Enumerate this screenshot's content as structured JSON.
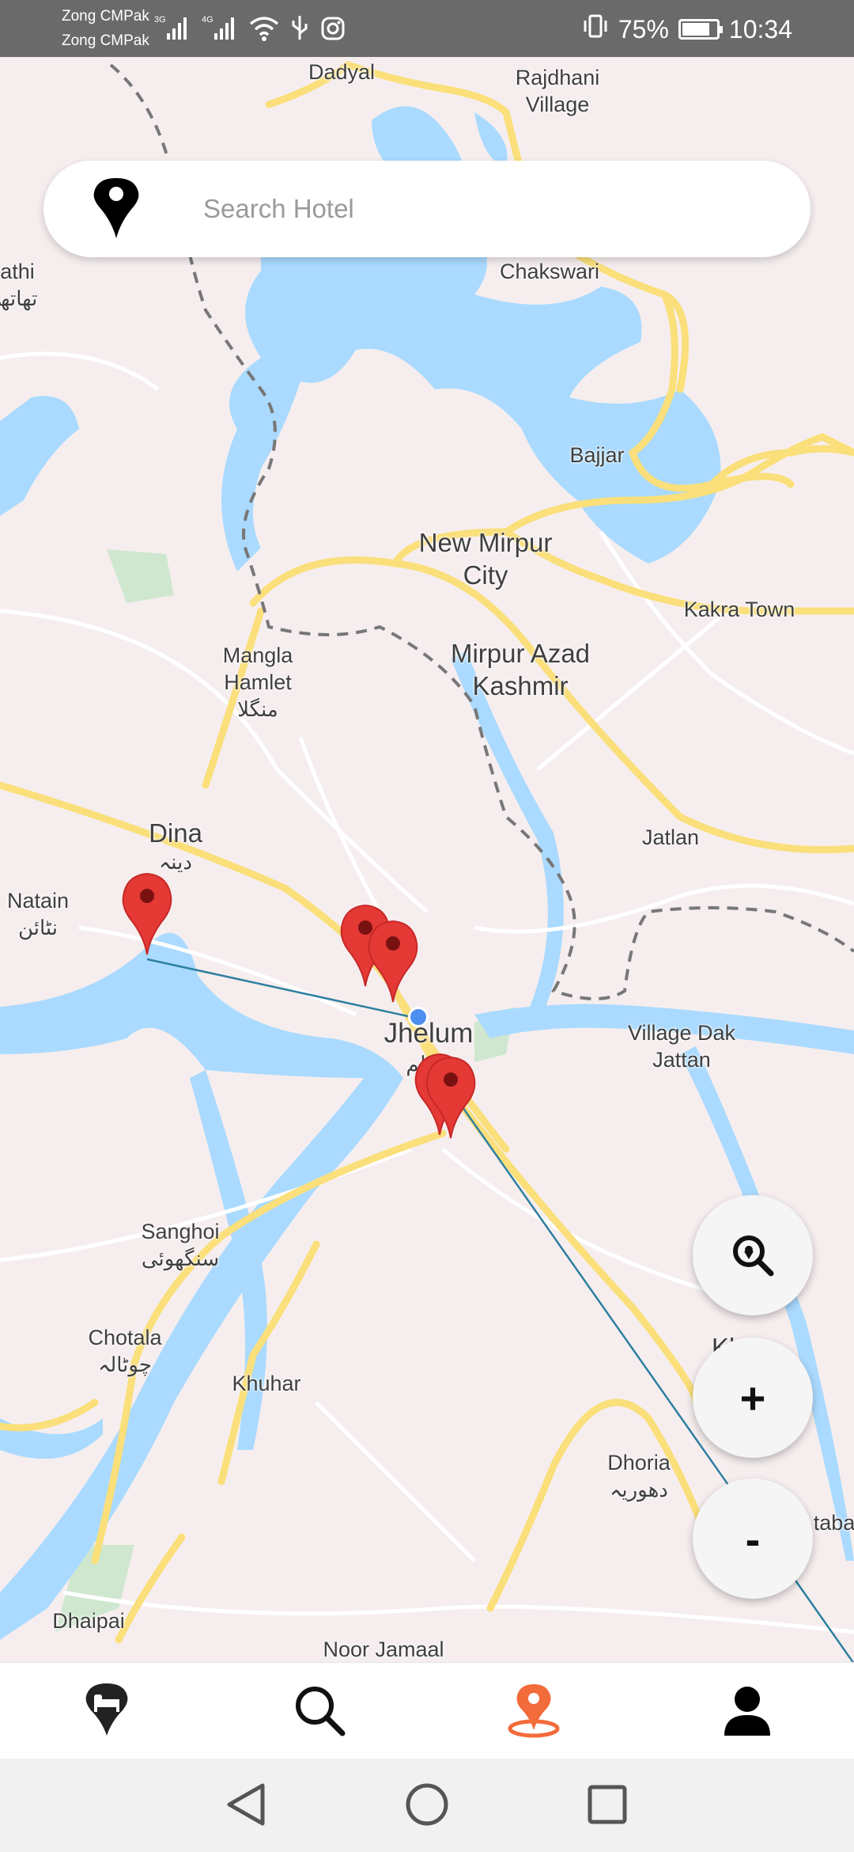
{
  "status_bar": {
    "carrier_1": "Zong CMPak",
    "carrier_2": "Zong CMPak",
    "signal_1": "3G",
    "signal_2": "4G",
    "battery": "75%",
    "time": "10:34"
  },
  "search": {
    "placeholder": "Search Hotel",
    "icon": "map-pin-icon"
  },
  "map": {
    "places": [
      {
        "name": "Dadyal"
      },
      {
        "name": "Rajdhani Village"
      },
      {
        "name": "Chakswari"
      },
      {
        "name": "Bajjar"
      },
      {
        "name": "New Mirpur City"
      },
      {
        "name": "Kakra Town"
      },
      {
        "name": "Mirpur Azad Kashmir"
      },
      {
        "name": "Mangla Hamlet",
        "urdu": "منگلا"
      },
      {
        "name": "Dina",
        "urdu": "دینہ"
      },
      {
        "name": "Jatlan"
      },
      {
        "name": "Natain",
        "urdu": "نٹائن"
      },
      {
        "name": "Jhelum",
        "urdu": "جہلم"
      },
      {
        "name": "Village Dak Jattan"
      },
      {
        "name": "Sanghoi",
        "urdu": "سنگھوئی"
      },
      {
        "name": "Chotala",
        "urdu": "چوٹالہ"
      },
      {
        "name": "Khuhar"
      },
      {
        "name": "Dhoria",
        "urdu": "دھوریہ"
      },
      {
        "name": "Dhaipai"
      },
      {
        "name": "Noor Jamaal"
      },
      {
        "name": "athi",
        "urdu": "تھاتھ"
      },
      {
        "name": "Kh"
      },
      {
        "name": "taba"
      }
    ],
    "markers_count": 5
  },
  "fabs": {
    "search_zoom_icon": "map-search-icon",
    "zoom_in": "+",
    "zoom_out": "-"
  },
  "bottom_nav": {
    "items": [
      {
        "icon": "hotel-pin-icon",
        "active": false
      },
      {
        "icon": "search-icon",
        "active": false
      },
      {
        "icon": "location-icon",
        "active": true
      },
      {
        "icon": "profile-icon",
        "active": false
      }
    ],
    "active_color": "#f26b3a"
  },
  "colors": {
    "marker": "#e53935",
    "water": "#aadaff",
    "road": "#ffe38a",
    "user_dot": "#4d8ff0"
  }
}
